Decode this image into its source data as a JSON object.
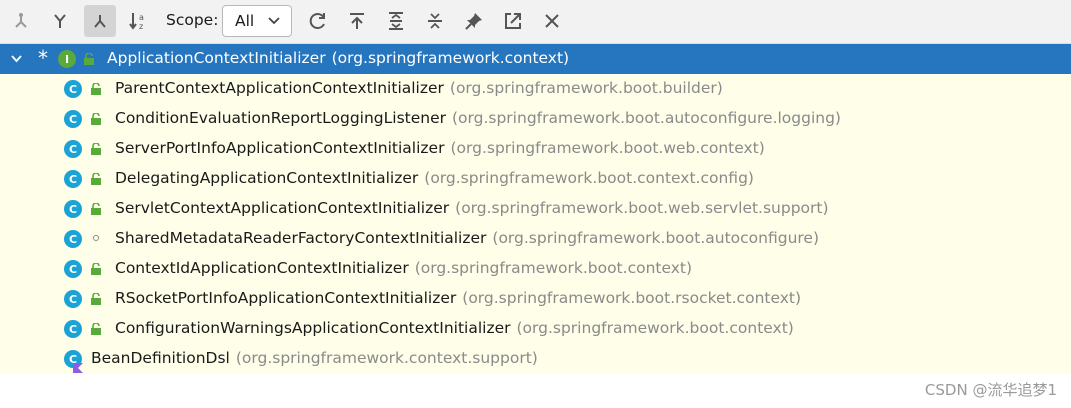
{
  "toolbar": {
    "buttons": [
      {
        "name": "supertypes-hierarchy-button",
        "icon": "supertypes-icon"
      },
      {
        "name": "subtypes-hierarchy-button",
        "icon": "subtypes-icon"
      },
      {
        "name": "class-hierarchy-button",
        "icon": "class-hierarchy-icon",
        "active": true
      },
      {
        "name": "sort-alphabetically-button",
        "icon": "sort-alpha-icon"
      }
    ],
    "scope_label": "Scope:",
    "scope_value": "All",
    "actions": [
      {
        "name": "refresh-button",
        "icon": "refresh-icon"
      },
      {
        "name": "scroll-to-source-button",
        "icon": "scroll-to-source-icon"
      },
      {
        "name": "expand-all-button",
        "icon": "expand-all-icon"
      },
      {
        "name": "collapse-all-button",
        "icon": "collapse-all-icon"
      },
      {
        "name": "pin-tab-button",
        "icon": "pin-icon"
      },
      {
        "name": "open-in-window-button",
        "icon": "open-window-icon"
      },
      {
        "name": "close-button",
        "icon": "close-icon"
      }
    ]
  },
  "tree": {
    "root": {
      "marker": "*",
      "name": "ApplicationContextInitializer",
      "package": "(org.springframework.context)",
      "kind": "interface",
      "icon_letter": "I"
    },
    "children": [
      {
        "name": "ParentContextApplicationContextInitializer",
        "package": "(org.springframework.boot.builder)",
        "visibility": "public"
      },
      {
        "name": "ConditionEvaluationReportLoggingListener",
        "package": "(org.springframework.boot.autoconfigure.logging)",
        "visibility": "public"
      },
      {
        "name": "ServerPortInfoApplicationContextInitializer",
        "package": "(org.springframework.boot.web.context)",
        "visibility": "public"
      },
      {
        "name": "DelegatingApplicationContextInitializer",
        "package": "(org.springframework.boot.context.config)",
        "visibility": "public"
      },
      {
        "name": "ServletContextApplicationContextInitializer",
        "package": "(org.springframework.boot.web.servlet.support)",
        "visibility": "public"
      },
      {
        "name": "SharedMetadataReaderFactoryContextInitializer",
        "package": "(org.springframework.boot.autoconfigure)",
        "visibility": "package-private"
      },
      {
        "name": "ContextIdApplicationContextInitializer",
        "package": "(org.springframework.boot.context)",
        "visibility": "public"
      },
      {
        "name": "RSocketPortInfoApplicationContextInitializer",
        "package": "(org.springframework.boot.rsocket.context)",
        "visibility": "public"
      },
      {
        "name": "ConfigurationWarningsApplicationContextInitializer",
        "package": "(org.springframework.boot.context)",
        "visibility": "public"
      },
      {
        "name": "BeanDefinitionDsl",
        "package": "(org.springframework.context.support)",
        "visibility": "kotlin"
      }
    ],
    "class_icon_letter": "C"
  },
  "watermark": "CSDN @流华追梦1",
  "colors": {
    "selection": "#2675bf",
    "tree_background": "#fefee9",
    "class_icon": "#1aa3d4",
    "interface_icon": "#5aa93b",
    "lock": "#5aa93b"
  }
}
